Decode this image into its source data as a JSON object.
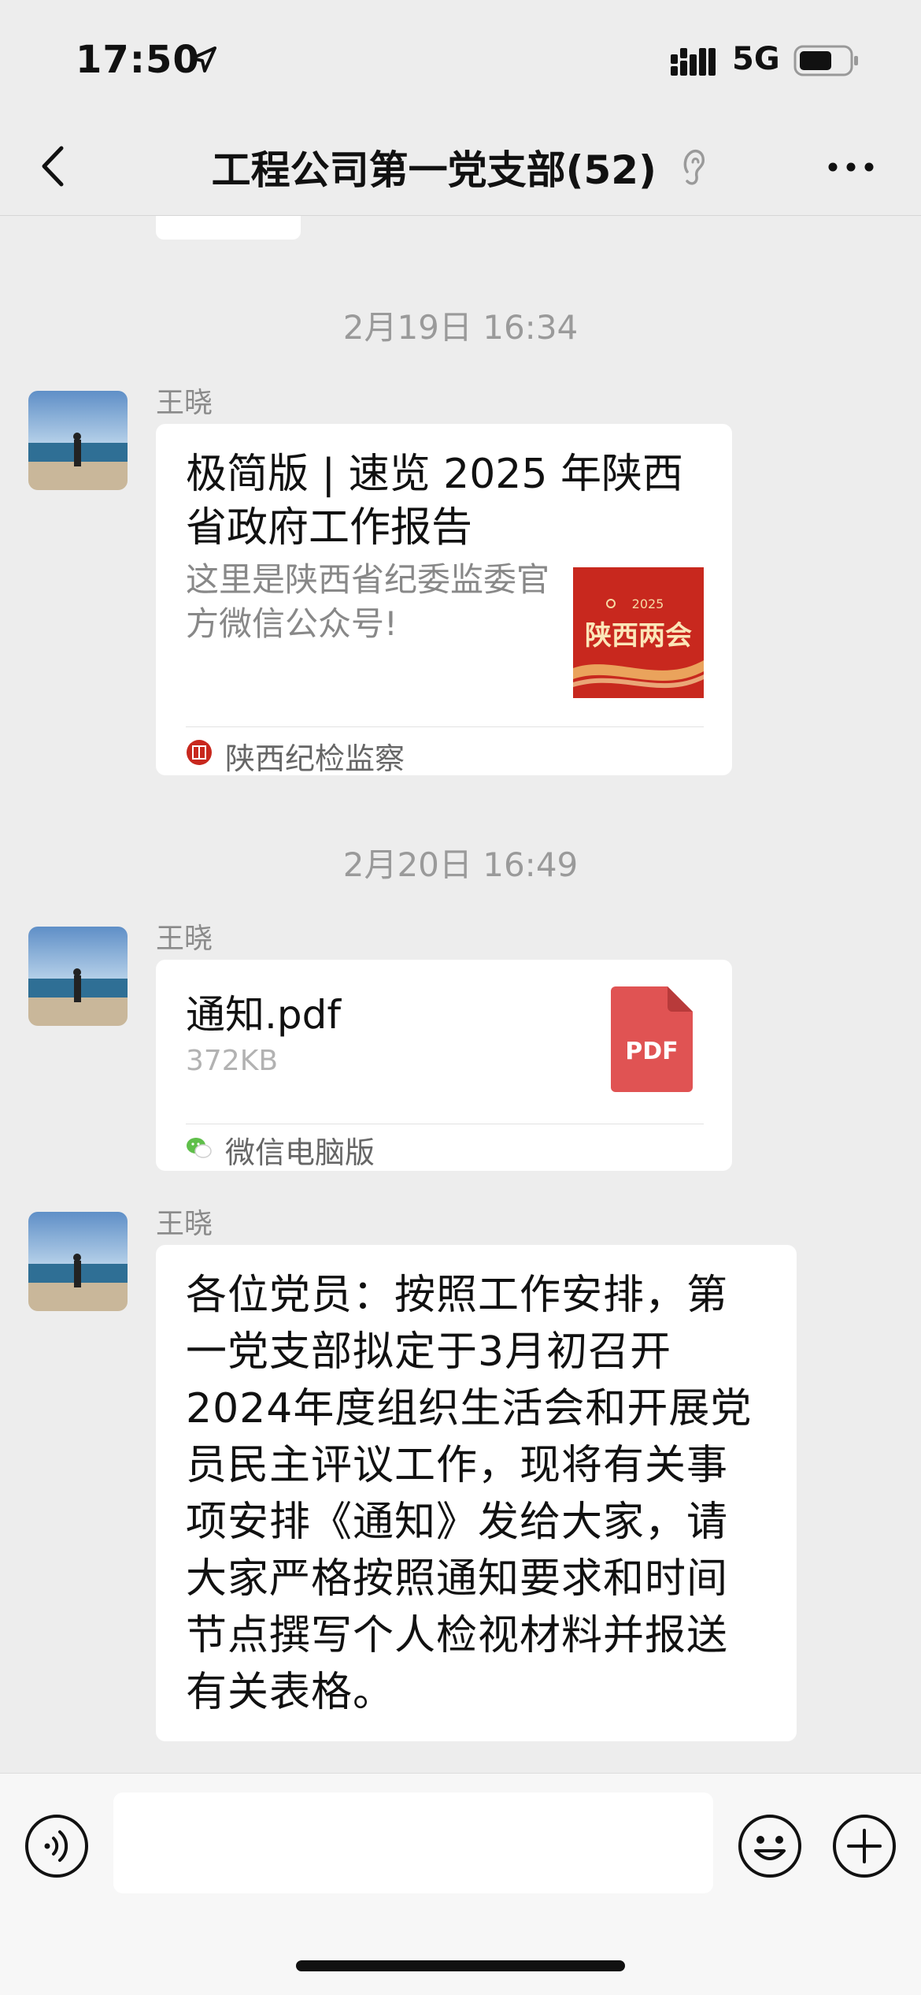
{
  "status_bar": {
    "time": "17:50",
    "network": "5G",
    "icons": [
      "location-arrow-icon",
      "signal-icon",
      "battery-icon"
    ]
  },
  "nav": {
    "title": "工程公司第一党支部(52)",
    "icons": [
      "back-icon",
      "ear-icon",
      "more-icon"
    ]
  },
  "messages": [
    {
      "type": "timestamp",
      "text": "2月19日 16:34"
    },
    {
      "type": "article",
      "sender": "王晓",
      "title": "极简版 | 速览 2025 年陕西省政府工作报告",
      "description": "这里是陕西省纪委监委官方微信公众号!",
      "thumbnail_year": "2025",
      "thumbnail_text": "陕西两会",
      "source_name": "陕西纪检监察"
    },
    {
      "type": "timestamp",
      "text": "2月20日 16:49"
    },
    {
      "type": "file",
      "sender": "王晓",
      "file_name": "通知.pdf",
      "file_size": "372KB",
      "file_icon_label": "PDF",
      "source_name": "微信电脑版"
    },
    {
      "type": "text",
      "sender": "王晓",
      "text": "各位党员：按照工作安排，第一党支部拟定于3月初召开2024年度组织生活会和开展党员民主评议工作，现将有关事项安排《通知》发给大家，请大家严格按照通知要求和时间节点撰写个人检视材料并报送有关表格。"
    }
  ],
  "input_bar": {
    "input_value": "",
    "icons": [
      "voice-icon",
      "emoji-icon",
      "plus-icon"
    ]
  },
  "colors": {
    "background": "#ededed",
    "bubble": "#ffffff",
    "pdf_red": "#e05353",
    "thumb_red": "#c8281e"
  }
}
